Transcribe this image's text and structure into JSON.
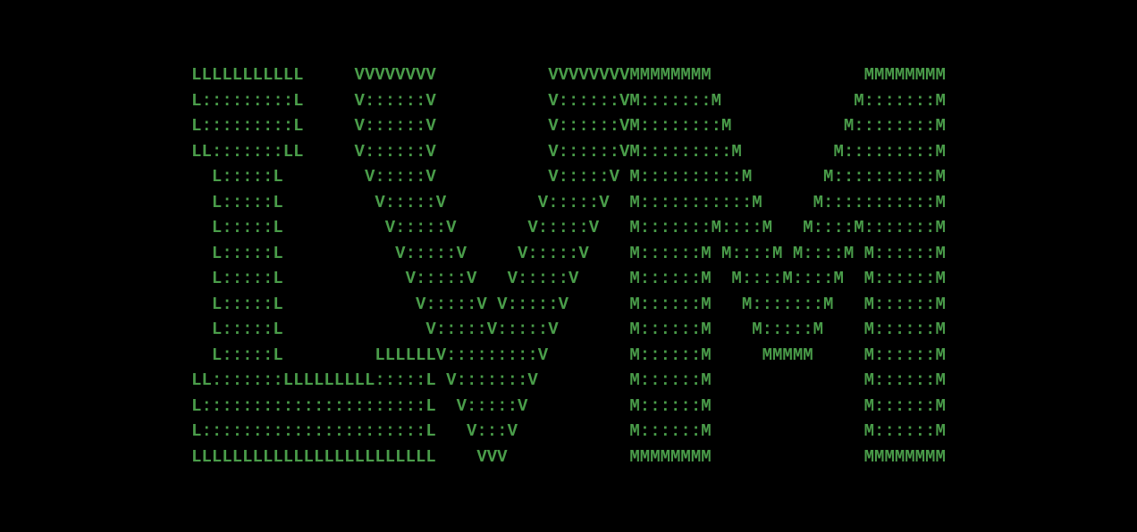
{
  "ascii_art": {
    "represents": "LVM",
    "color": "#4a9d4a",
    "background": "#000000",
    "lines": [
      "LLLLLLLLLLL     VVVVVVVV           VVVVVVVVMMMMMMMM               MMMMMMMM",
      "L:::::::::L     V::::::V           V::::::VM:::::::M             M:::::::M",
      "L:::::::::L     V::::::V           V::::::VM::::::::M           M::::::::M",
      "LL:::::::LL     V::::::V           V::::::VM:::::::::M         M:::::::::M",
      "  L:::::L        V:::::V           V:::::V M::::::::::M       M::::::::::M",
      "  L:::::L         V:::::V         V:::::V  M:::::::::::M     M:::::::::::M",
      "  L:::::L          V:::::V       V:::::V   M:::::::M::::M   M::::M:::::::M",
      "  L:::::L           V:::::V     V:::::V    M::::::M M::::M M::::M M::::::M",
      "  L:::::L            V:::::V   V:::::V     M::::::M  M::::M::::M  M::::::M",
      "  L:::::L             V:::::V V:::::V      M::::::M   M:::::::M   M::::::M",
      "  L:::::L              V:::::V:::::V       M::::::M    M:::::M    M::::::M",
      "  L:::::L         LLLLLLV:::::::::V        M::::::M     MMMMM     M::::::M",
      "LL:::::::LLLLLLLLL:::::L V:::::::V         M::::::M               M::::::M",
      "L::::::::::::::::::::::L  V:::::V          M::::::M               M::::::M",
      "L::::::::::::::::::::::L   V:::V           M::::::M               M::::::M",
      "LLLLLLLLLLLLLLLLLLLLLLLL    VVV            MMMMMMMM               MMMMMMMM"
    ]
  }
}
